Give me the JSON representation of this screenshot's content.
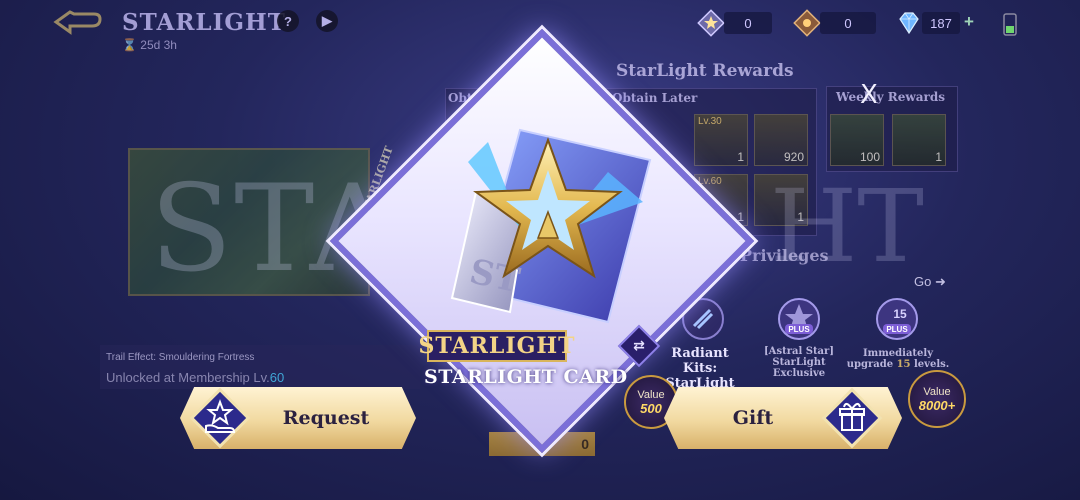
{
  "header": {
    "title": "STARLIGHT",
    "timer": "25d  3h",
    "help_label": "?",
    "play_label": "▶"
  },
  "resources": [
    {
      "icon": "starlight-ticket-icon",
      "value": "0"
    },
    {
      "icon": "skin-fragment-icon",
      "value": "0"
    },
    {
      "icon": "diamond-icon",
      "value": "187"
    }
  ],
  "rewards": {
    "section_title": "StarLight Rewards",
    "obtain_now": "Obt",
    "obtain_later": "Obtain Later",
    "weekly_title": "Weekly Rewards",
    "items": [
      {
        "label": "Lv.30",
        "count": "1"
      },
      {
        "label": "",
        "count": "920"
      },
      {
        "label": "Lv.60",
        "count": "1"
      },
      {
        "label": "",
        "count": "1"
      }
    ],
    "weekly_items": [
      {
        "count": "100"
      },
      {
        "count": "1"
      }
    ]
  },
  "preview": {
    "big_text_left": "STA",
    "big_text_right": "HT",
    "side_label": "STARLIGHT",
    "trail_effect": "Trail Effect: Smouldering Fortress",
    "unlock_prefix": "Unlocked at Membership Lv.",
    "unlock_level": "60"
  },
  "privileges": {
    "title": "Privileges",
    "go_label": "Go",
    "radiant_kits": "Radiant Kits: StarLight",
    "astral_line1": "[Astral Star]",
    "astral_line2": "StarLight",
    "astral_line3": "Exclusive",
    "upgrade_line1": "Immediately",
    "upgrade_line2_prefix": "upgrade ",
    "upgrade_levels": "15",
    "upgrade_line2_suffix": " levels.",
    "plus_label": "PLUS",
    "plus_level": "15"
  },
  "card": {
    "banner": "STARLIGHT",
    "name": "STARLIGHT CARD",
    "swap_label": "⇄"
  },
  "purchase": {
    "price": "0",
    "value_label": "Value",
    "value_left": "500",
    "value_right": "8000+"
  },
  "actions": {
    "request_label": "Request",
    "gift_label": "Gift"
  },
  "close_label": "X"
}
